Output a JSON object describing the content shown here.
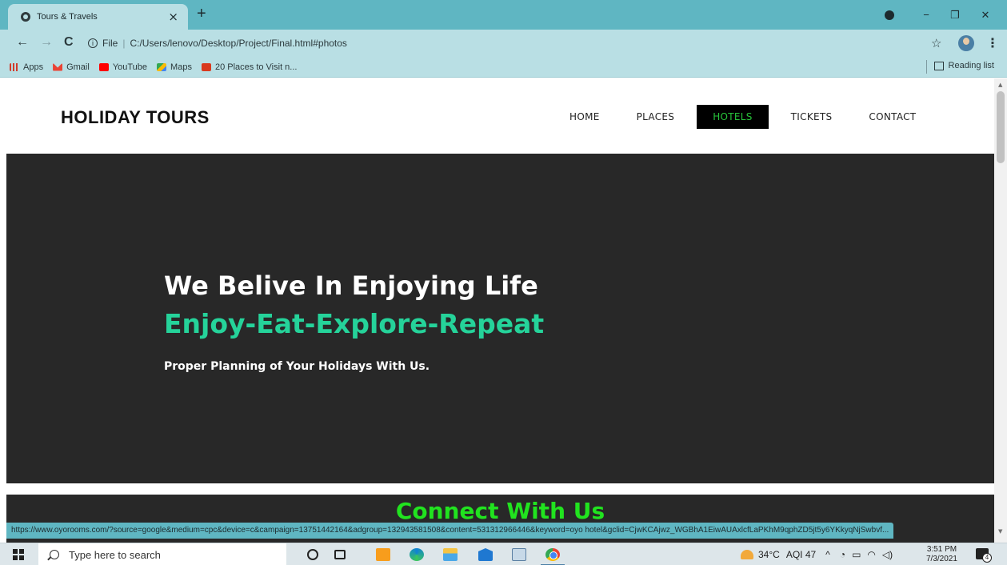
{
  "browser": {
    "tab_title": "Tours & Travels",
    "tab_close": "×",
    "new_tab": "+",
    "address_scheme": "File",
    "address_url": "C:/Users/lenovo/Desktop/Project/Final.html#photos",
    "window_controls": {
      "minimize": "−",
      "maximize": "❐",
      "close": "✕"
    },
    "bookmarks": [
      {
        "label": "Apps",
        "icon": "apps-grid-icon"
      },
      {
        "label": "Gmail",
        "icon": "gmail-icon"
      },
      {
        "label": "YouTube",
        "icon": "youtube-icon"
      },
      {
        "label": "Maps",
        "icon": "maps-icon"
      },
      {
        "label": "20 Places to Visit n...",
        "icon": "bookmark-site-icon"
      }
    ],
    "reading_list": "Reading list",
    "status_url": "https://www.oyorooms.com/?source=google&medium=cpc&device=c&campaign=13751442164&adgroup=132943581508&content=531312966446&keyword=oyo hotel&gclid=CjwKCAjwz_WGBhA1EiwAUAxlcfLaPKhM9qphZD5jt5y6YKkyqNjSwbvf..."
  },
  "site": {
    "brand": "HOLIDAY TOURS",
    "nav": [
      {
        "label": "HOME",
        "active": false
      },
      {
        "label": "PLACES",
        "active": false
      },
      {
        "label": "HOTELS",
        "active": true
      },
      {
        "label": "TICKETS",
        "active": false
      },
      {
        "label": "CONTACT",
        "active": false
      }
    ],
    "hero": {
      "headline": "We Belive In Enjoying Life",
      "tagline": "Enjoy-Eat-Explore-Repeat",
      "subtext": "Proper Planning of Your Holidays With Us."
    },
    "connect_heading": "Connect With Us"
  },
  "taskbar": {
    "search_placeholder": "Type here to search",
    "weather": "34°C",
    "aqi": "AQI 47",
    "time": "3:51 PM",
    "date": "7/3/2021",
    "notification_count": "4"
  },
  "colors": {
    "accent_green": "#21e31f",
    "tagline_green": "#25d39a",
    "hero_bg": "#282828",
    "chrome_teal": "#5fb6c2"
  }
}
